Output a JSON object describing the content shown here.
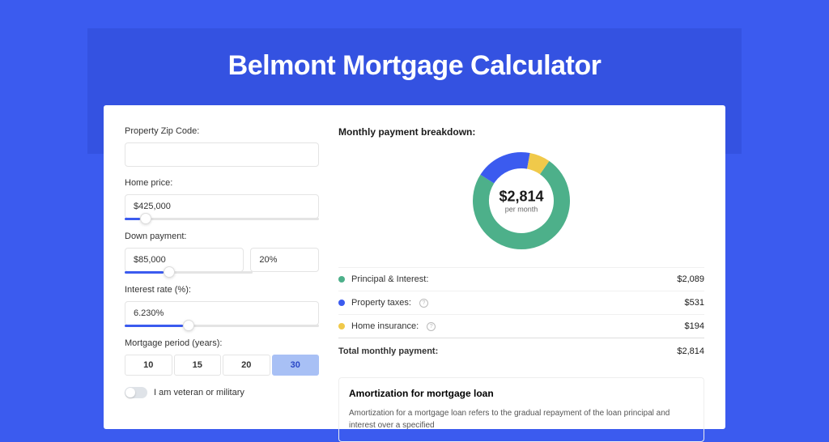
{
  "title": "Belmont Mortgage Calculator",
  "form": {
    "zip": {
      "label": "Property Zip Code:",
      "value": ""
    },
    "price": {
      "label": "Home price:",
      "value": "$425,000",
      "sliderPct": 8
    },
    "down": {
      "label": "Down payment:",
      "value": "$85,000",
      "pct": "20%",
      "sliderPct": 20
    },
    "rate": {
      "label": "Interest rate (%):",
      "value": "6.230%",
      "sliderPct": 30
    },
    "period": {
      "label": "Mortgage period (years):",
      "options": [
        "10",
        "15",
        "20",
        "30"
      ],
      "selected": "30"
    },
    "veteran": {
      "label": "I am veteran or military"
    }
  },
  "breakdown": {
    "heading": "Monthly payment breakdown:",
    "centerAmount": "$2,814",
    "centerSub": "per month",
    "rows": [
      {
        "color": "green",
        "label": "Principal & Interest:",
        "value": "$2,089",
        "info": false
      },
      {
        "color": "blue",
        "label": "Property taxes:",
        "value": "$531",
        "info": true
      },
      {
        "color": "yellow",
        "label": "Home insurance:",
        "value": "$194",
        "info": true
      }
    ],
    "total": {
      "label": "Total monthly payment:",
      "value": "$2,814"
    }
  },
  "amort": {
    "title": "Amortization for mortgage loan",
    "text": "Amortization for a mortgage loan refers to the gradual repayment of the loan principal and interest over a specified"
  },
  "chart_data": {
    "type": "pie",
    "title": "Monthly payment breakdown",
    "series": [
      {
        "name": "Principal & Interest",
        "value": 2089,
        "color": "#4db08a"
      },
      {
        "name": "Property taxes",
        "value": 531,
        "color": "#3b5bef"
      },
      {
        "name": "Home insurance",
        "value": 194,
        "color": "#f0c94a"
      }
    ],
    "total": 2814,
    "center_label": "$2,814 per month"
  }
}
